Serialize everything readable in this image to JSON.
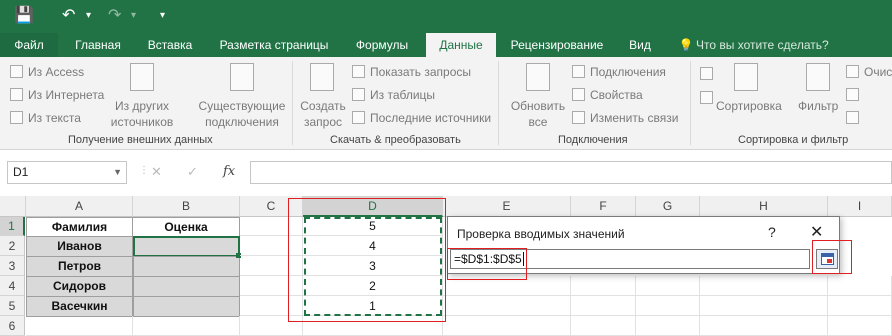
{
  "quick_access": {
    "save": "💾",
    "undo": "↶",
    "redo": "↷",
    "more": "▾"
  },
  "ribbon_tabs": [
    "Файл",
    "Главная",
    "Вставка",
    "Разметка страницы",
    "Формулы",
    "Данные",
    "Рецензирование",
    "Вид"
  ],
  "tell_me": "Что вы хотите сделать?",
  "ribbon": {
    "external": {
      "from_access": "Из Access",
      "from_web": "Из Интернета",
      "from_text": "Из текста",
      "other_1": "Из других",
      "other_2": "источников",
      "existing_1": "Существующие",
      "existing_2": "подключения",
      "group": "Получение внешних данных"
    },
    "transform": {
      "create_1": "Создать",
      "create_2": "запрос",
      "show_queries": "Показать запросы",
      "from_table": "Из таблицы",
      "recent": "Последние источники",
      "group": "Скачать & преобразовать"
    },
    "connections": {
      "refresh_1": "Обновить",
      "refresh_2": "все",
      "connections": "Подключения",
      "properties": "Свойства",
      "edit_links": "Изменить связи",
      "group": "Подключения"
    },
    "sort_filter": {
      "sort": "Сортировка",
      "filter": "Фильтр",
      "clear": "Очис",
      "group": "Сортировка и фильтр"
    }
  },
  "name_box": "D1",
  "formula_icons": {
    "cancel": "✕",
    "confirm": "✓",
    "fx": "fx"
  },
  "columns": [
    "A",
    "B",
    "C",
    "D",
    "E",
    "F",
    "G",
    "H",
    "I"
  ],
  "rows": [
    "1",
    "2",
    "3",
    "4",
    "5",
    "6"
  ],
  "cells": {
    "A1": "Фамилия",
    "B1": "Оценка",
    "A2": "Иванов",
    "A3": "Петров",
    "A4": "Сидоров",
    "A5": "Васечкин",
    "D1": "5",
    "D2": "4",
    "D3": "3",
    "D4": "2",
    "D5": "1"
  },
  "dialog": {
    "title": "Проверка вводимых значений",
    "help": "?",
    "close": "✕",
    "value": "=$D$1:$D$5"
  },
  "colors": {
    "accent": "#217346",
    "annotation": "#e02020"
  }
}
